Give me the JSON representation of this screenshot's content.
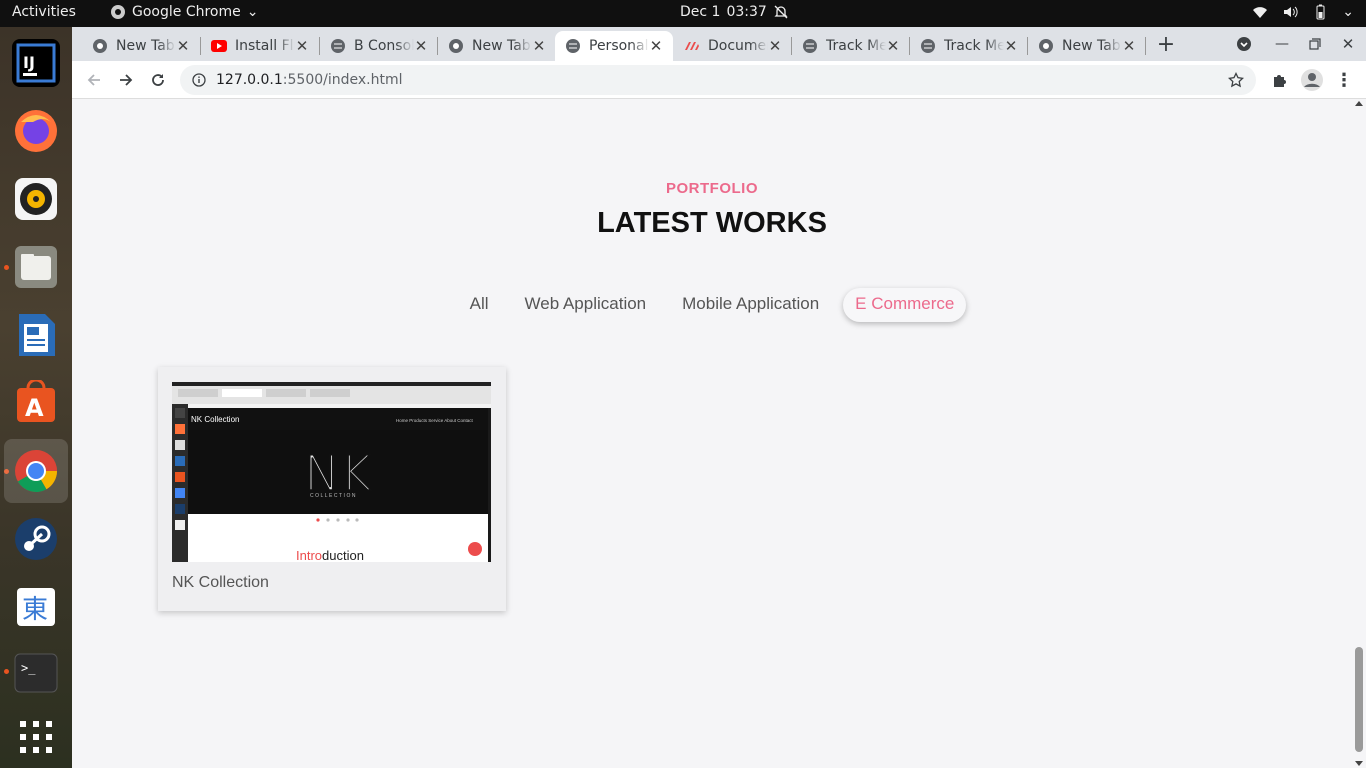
{
  "topbar": {
    "activities": "Activities",
    "app_name": "Google Chrome",
    "date": "Dec 1",
    "time": "03:37"
  },
  "dock": {
    "apps": [
      "intellij-icon",
      "firefox-icon",
      "rhythmbox-icon",
      "files-icon",
      "writer-icon",
      "software-icon",
      "chrome-icon",
      "steam-icon",
      "mozc-icon",
      "terminal-icon",
      "app-grid-icon"
    ]
  },
  "tabs": [
    {
      "title": "New Tab"
    },
    {
      "title": "Install Flutter"
    },
    {
      "title": "B Console"
    },
    {
      "title": "New Tab"
    },
    {
      "title": "Personal"
    },
    {
      "title": "Documents"
    },
    {
      "title": "Track Me"
    },
    {
      "title": "Track Me"
    },
    {
      "title": "New Tab"
    }
  ],
  "toolbar": {
    "url_host": "127.0.0.1",
    "url_rest": ":5500/index.html"
  },
  "portfolio": {
    "subtitle": "PORTFOLIO",
    "title": "LATEST WORKS",
    "filters": [
      "All",
      "Web Application",
      "Mobile Application",
      "E Commerce"
    ],
    "active_filter": "E Commerce",
    "card_title": "NK Collection",
    "thumb_site_name": "NK Collection",
    "thumb_logo": "NK",
    "thumb_logo_sub": "COLLECTION",
    "thumb_intro_a": "Intro",
    "thumb_intro_b": "duction"
  },
  "colors": {
    "accent": "#ec6a8c"
  }
}
